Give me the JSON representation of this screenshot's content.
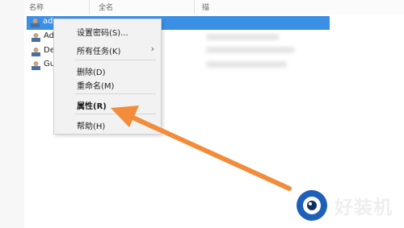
{
  "header": {
    "col_name": "名称",
    "col_fullname": "全名",
    "col_desc": "描"
  },
  "users": [
    {
      "name": "adm",
      "selected": true
    },
    {
      "name": "Ad"
    },
    {
      "name": "De"
    },
    {
      "name": "Gu"
    }
  ],
  "context_menu": {
    "set_password": "设置密码(S)...",
    "all_tasks": "所有任务(K)",
    "delete": "删除(D)",
    "rename": "重命名(M)",
    "properties": "属性(R)",
    "help": "帮助(H)"
  },
  "watermark": {
    "text": "好装机"
  },
  "colors": {
    "selection": "#3b8fe4",
    "arrow": "#f28c3a",
    "logo_blue": "#1e5fb8"
  }
}
